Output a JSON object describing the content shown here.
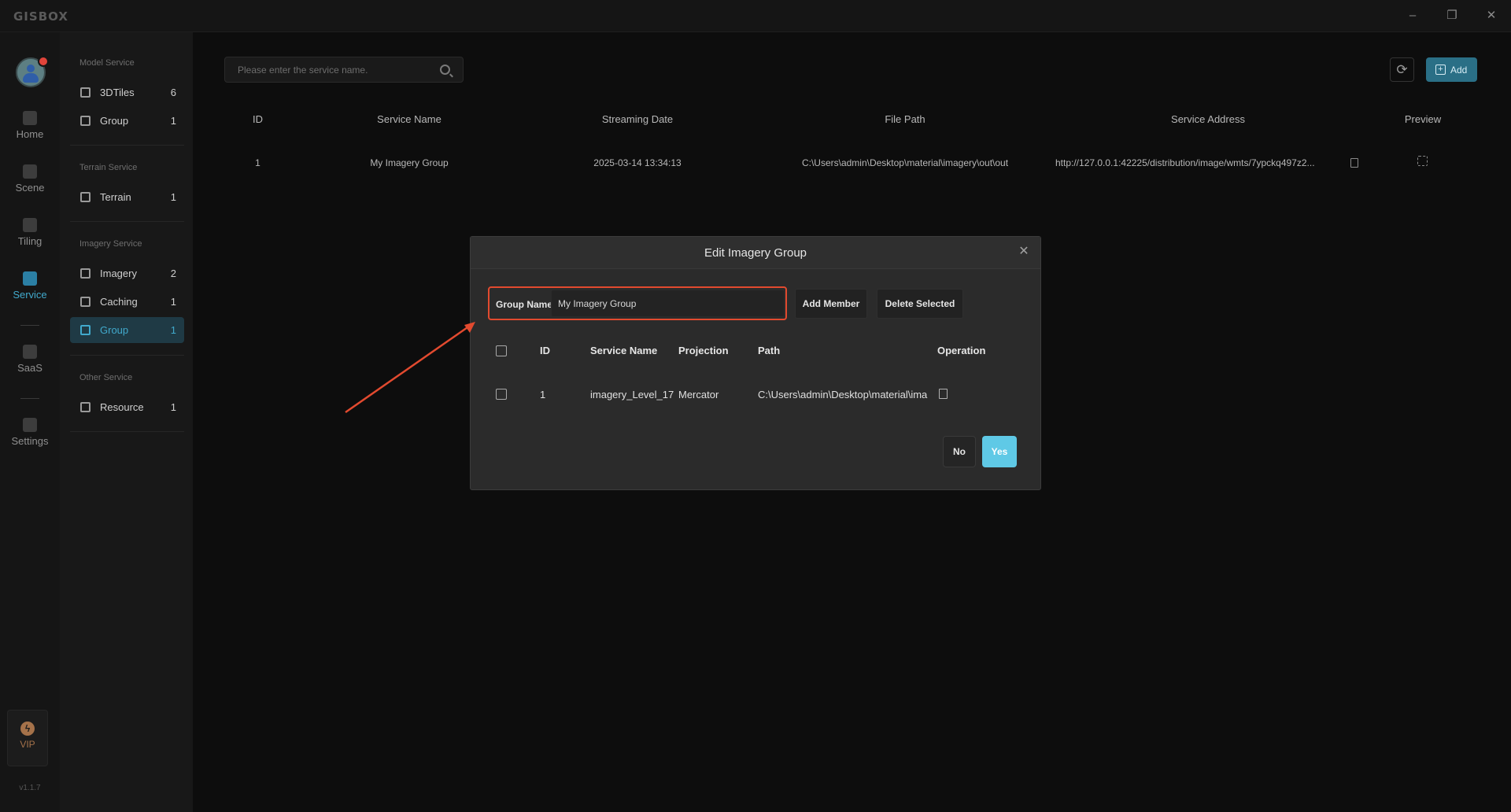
{
  "app": {
    "logo": "GISBOX",
    "version": "v1.1.7"
  },
  "window": {
    "minimize": "–",
    "restore": "❐",
    "close": "✕"
  },
  "rail": {
    "items": [
      {
        "label": "Home",
        "icon": "home-icon"
      },
      {
        "label": "Scene",
        "icon": "scene-icon"
      },
      {
        "label": "Tiling",
        "icon": "tiling-icon"
      },
      {
        "label": "Service",
        "icon": "service-icon",
        "active": true
      },
      {
        "label": "SaaS",
        "icon": "saas-icon"
      },
      {
        "label": "Settings",
        "icon": "settings-icon"
      }
    ],
    "vip": "VIP"
  },
  "sidebar": {
    "sections": [
      {
        "title": "Model Service",
        "items": [
          {
            "label": "3DTiles",
            "count": "6"
          },
          {
            "label": "Group",
            "count": "1"
          }
        ]
      },
      {
        "title": "Terrain Service",
        "items": [
          {
            "label": "Terrain",
            "count": "1"
          }
        ]
      },
      {
        "title": "Imagery Service",
        "items": [
          {
            "label": "Imagery",
            "count": "2"
          },
          {
            "label": "Caching",
            "count": "1"
          },
          {
            "label": "Group",
            "count": "1",
            "active": true
          }
        ]
      },
      {
        "title": "Other Service",
        "items": [
          {
            "label": "Resource",
            "count": "1"
          }
        ]
      }
    ]
  },
  "toolbar": {
    "search_placeholder": "Please enter the service name.",
    "refresh_icon": "⟳",
    "add_label": "Add",
    "add_icon": "+"
  },
  "table": {
    "headers": [
      "ID",
      "Service Name",
      "Streaming Date",
      "File Path",
      "Service Address",
      "Preview"
    ],
    "rows": [
      {
        "id": "1",
        "name": "My Imagery Group",
        "date": "2025-03-14 13:34:13",
        "path": "C:\\Users\\admin\\Desktop\\material\\imagery\\out\\out",
        "address": "http://127.0.0.1:42225/distribution/image/wmts/7ypckq497z2..."
      }
    ]
  },
  "modal": {
    "title": "Edit Imagery Group",
    "close_icon": "✕",
    "group_name_label": "Group Name",
    "group_name_value": "My Imagery Group",
    "add_member": "Add Member",
    "delete_selected": "Delete Selected",
    "headers": [
      "ID",
      "Service Name",
      "Projection",
      "Path",
      "Operation"
    ],
    "rows": [
      {
        "id": "1",
        "name": "imagery_Level_17",
        "projection": "Mercator",
        "path": "C:\\Users\\admin\\Desktop\\material\\ima"
      }
    ],
    "no": "No",
    "yes": "Yes"
  },
  "colors": {
    "accent": "#41a9cc",
    "highlight": "#e24a2f",
    "primary_button": "#5fc9e6"
  }
}
